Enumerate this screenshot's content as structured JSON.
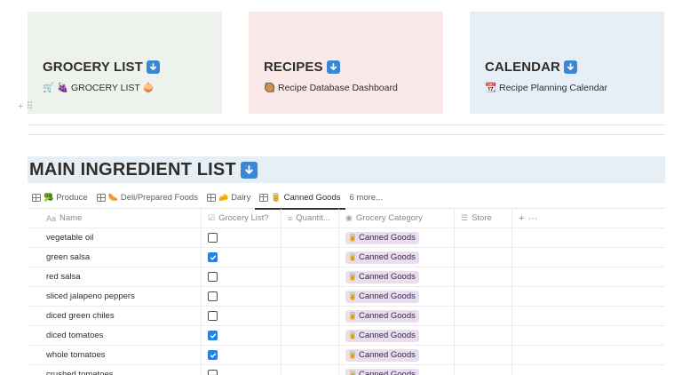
{
  "cards": [
    {
      "title": "GROCERY LIST",
      "link_text": "🛒 🍇 GROCERY LIST 🧅",
      "color": "#edf3ec"
    },
    {
      "title": "RECIPES",
      "link_text": "🥘 Recipe Database Dashboard",
      "color": "#fbe9ea"
    },
    {
      "title": "CALENDAR",
      "link_text": "📆 Recipe Planning Calendar",
      "color": "#e7eff6"
    }
  ],
  "block_controls": {
    "add": "+",
    "drag": "⠿"
  },
  "section": {
    "title": "MAIN INGREDIENT LIST",
    "background": "#e7eff6"
  },
  "tabs": [
    {
      "emoji": "🥦",
      "label": "Produce"
    },
    {
      "emoji": "🌭",
      "label": "Deli/Prepared Foods"
    },
    {
      "emoji": "🧀",
      "label": "Dairy"
    },
    {
      "emoji": "🥫",
      "label": "Canned Goods",
      "active": true
    },
    {
      "label": "6 more..."
    }
  ],
  "table": {
    "columns": [
      {
        "icon": "Aa",
        "label": "Name"
      },
      {
        "icon": "☑",
        "label": "Grocery List?"
      },
      {
        "icon": "≡",
        "label": "Quantit..."
      },
      {
        "icon": "◉",
        "label": "Grocery Category"
      },
      {
        "icon": "☰",
        "label": "Store"
      }
    ],
    "add_column": "+",
    "more_options": "···",
    "rows": [
      {
        "name": "vegetable oil",
        "checked": false,
        "category": "Canned Goods"
      },
      {
        "name": "green salsa",
        "checked": true,
        "category": "Canned Goods"
      },
      {
        "name": "red salsa",
        "checked": false,
        "category": "Canned Goods"
      },
      {
        "name": "sliced jalapeno peppers",
        "checked": false,
        "category": "Canned Goods"
      },
      {
        "name": "diced green chiles",
        "checked": false,
        "category": "Canned Goods"
      },
      {
        "name": "diced tomatoes",
        "checked": true,
        "category": "Canned Goods"
      },
      {
        "name": "whole tomatoes",
        "checked": true,
        "category": "Canned Goods"
      },
      {
        "name": "crushed tomatoes",
        "checked": false,
        "category": "Canned Goods"
      }
    ],
    "category_emoji": "🥫",
    "tag_color": "#e8deee",
    "checkbox_color": "#2383e2"
  }
}
